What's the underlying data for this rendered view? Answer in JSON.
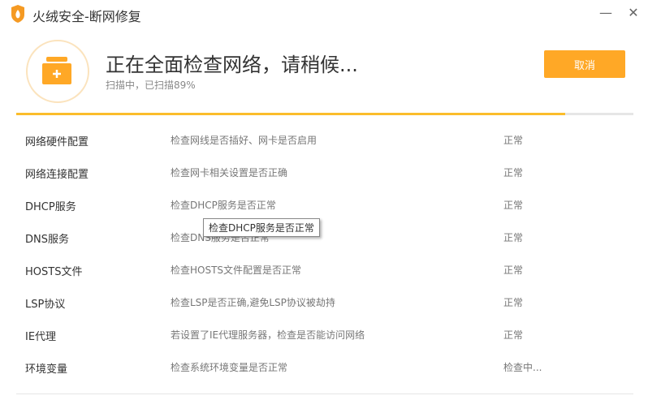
{
  "window": {
    "title": "火绒安全-断网修复",
    "minimize_icon": "minimize-icon",
    "close_icon": "close-icon"
  },
  "header": {
    "heading": "正在全面检查网络，请稍候...",
    "status": "扫描中，已扫描89%",
    "progress_percent": 89,
    "cancel_label": "取消"
  },
  "colors": {
    "accent": "#ffa826",
    "progress": "#fbbd2b"
  },
  "rows": [
    {
      "name": "网络硬件配置",
      "desc": "检查网线是否插好、网卡是否启用",
      "status": "正常"
    },
    {
      "name": "网络连接配置",
      "desc": "检查网卡相关设置是否正确",
      "status": "正常"
    },
    {
      "name": "DHCP服务",
      "desc": "检查DHCP服务是否正常",
      "status": "正常"
    },
    {
      "name": "DNS服务",
      "desc": "检查DNS服务是否正常",
      "status": "正常"
    },
    {
      "name": "HOSTS文件",
      "desc": "检查HOSTS文件配置是否正常",
      "status": "正常"
    },
    {
      "name": "LSP协议",
      "desc": "检查LSP是否正确,避免LSP协议被劫持",
      "status": "正常"
    },
    {
      "name": "IE代理",
      "desc": "若设置了IE代理服务器，检查是否能访问网络",
      "status": "正常"
    },
    {
      "name": "环境变量",
      "desc": "检查系统环境变量是否正常",
      "status": "检查中..."
    }
  ],
  "tooltip": "检查DHCP服务是否正常"
}
